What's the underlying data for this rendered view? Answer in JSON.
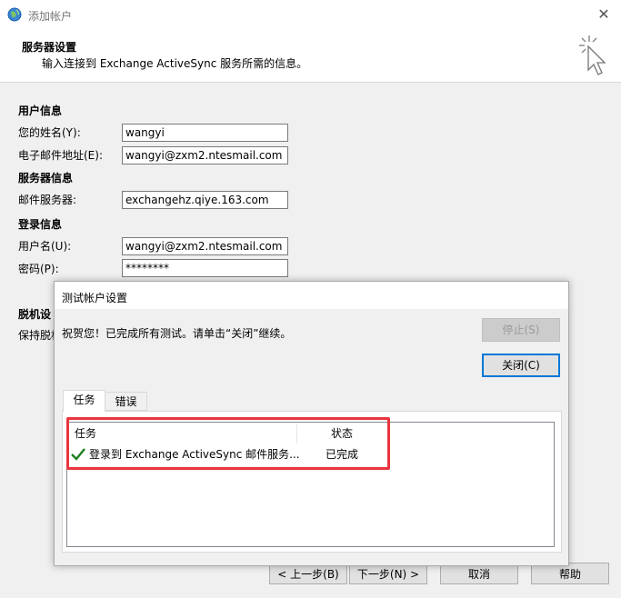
{
  "window": {
    "title": "添加帐户",
    "close_glyph": "✕"
  },
  "header": {
    "title": "服务器设置",
    "subtitle": "输入连接到 Exchange ActiveSync 服务所需的信息。"
  },
  "user_info": {
    "section": "用户信息",
    "name_label": "您的姓名(Y):",
    "name_value": "wangyi",
    "email_label": "电子邮件地址(E):",
    "email_value": "wangyi@zxm2.ntesmail.com"
  },
  "server_info": {
    "section": "服务器信息",
    "server_label": "邮件服务器:",
    "server_value": "exchangehz.qiye.163.com"
  },
  "login_info": {
    "section": "登录信息",
    "username_label": "用户名(U):",
    "username_value": "wangyi@zxm2.ntesmail.com",
    "password_label": "密码(P):",
    "password_value": "********"
  },
  "offline": {
    "section_partial": "脱机设",
    "label_partial": "保持脱机"
  },
  "dialog": {
    "title": "测试帐户设置",
    "message": "祝贺您！已完成所有测试。请单击“关闭”继续。",
    "stop_label": "停止(S)",
    "close_label": "关闭(C)",
    "tabs": [
      "任务",
      "错误"
    ],
    "columns": [
      "任务",
      "状态"
    ],
    "rows": [
      {
        "task": "登录到 Exchange ActiveSync 邮件服务...",
        "status": "已完成"
      }
    ]
  },
  "nav": {
    "back_label": "< 上一步(B)",
    "next_label": "下一步(N) >",
    "cancel_label": "取消",
    "help_label": "帮助"
  },
  "colors": {
    "highlight": "#e8353d",
    "default_button_border": "#0078d7",
    "check": "#1e7e1e"
  }
}
